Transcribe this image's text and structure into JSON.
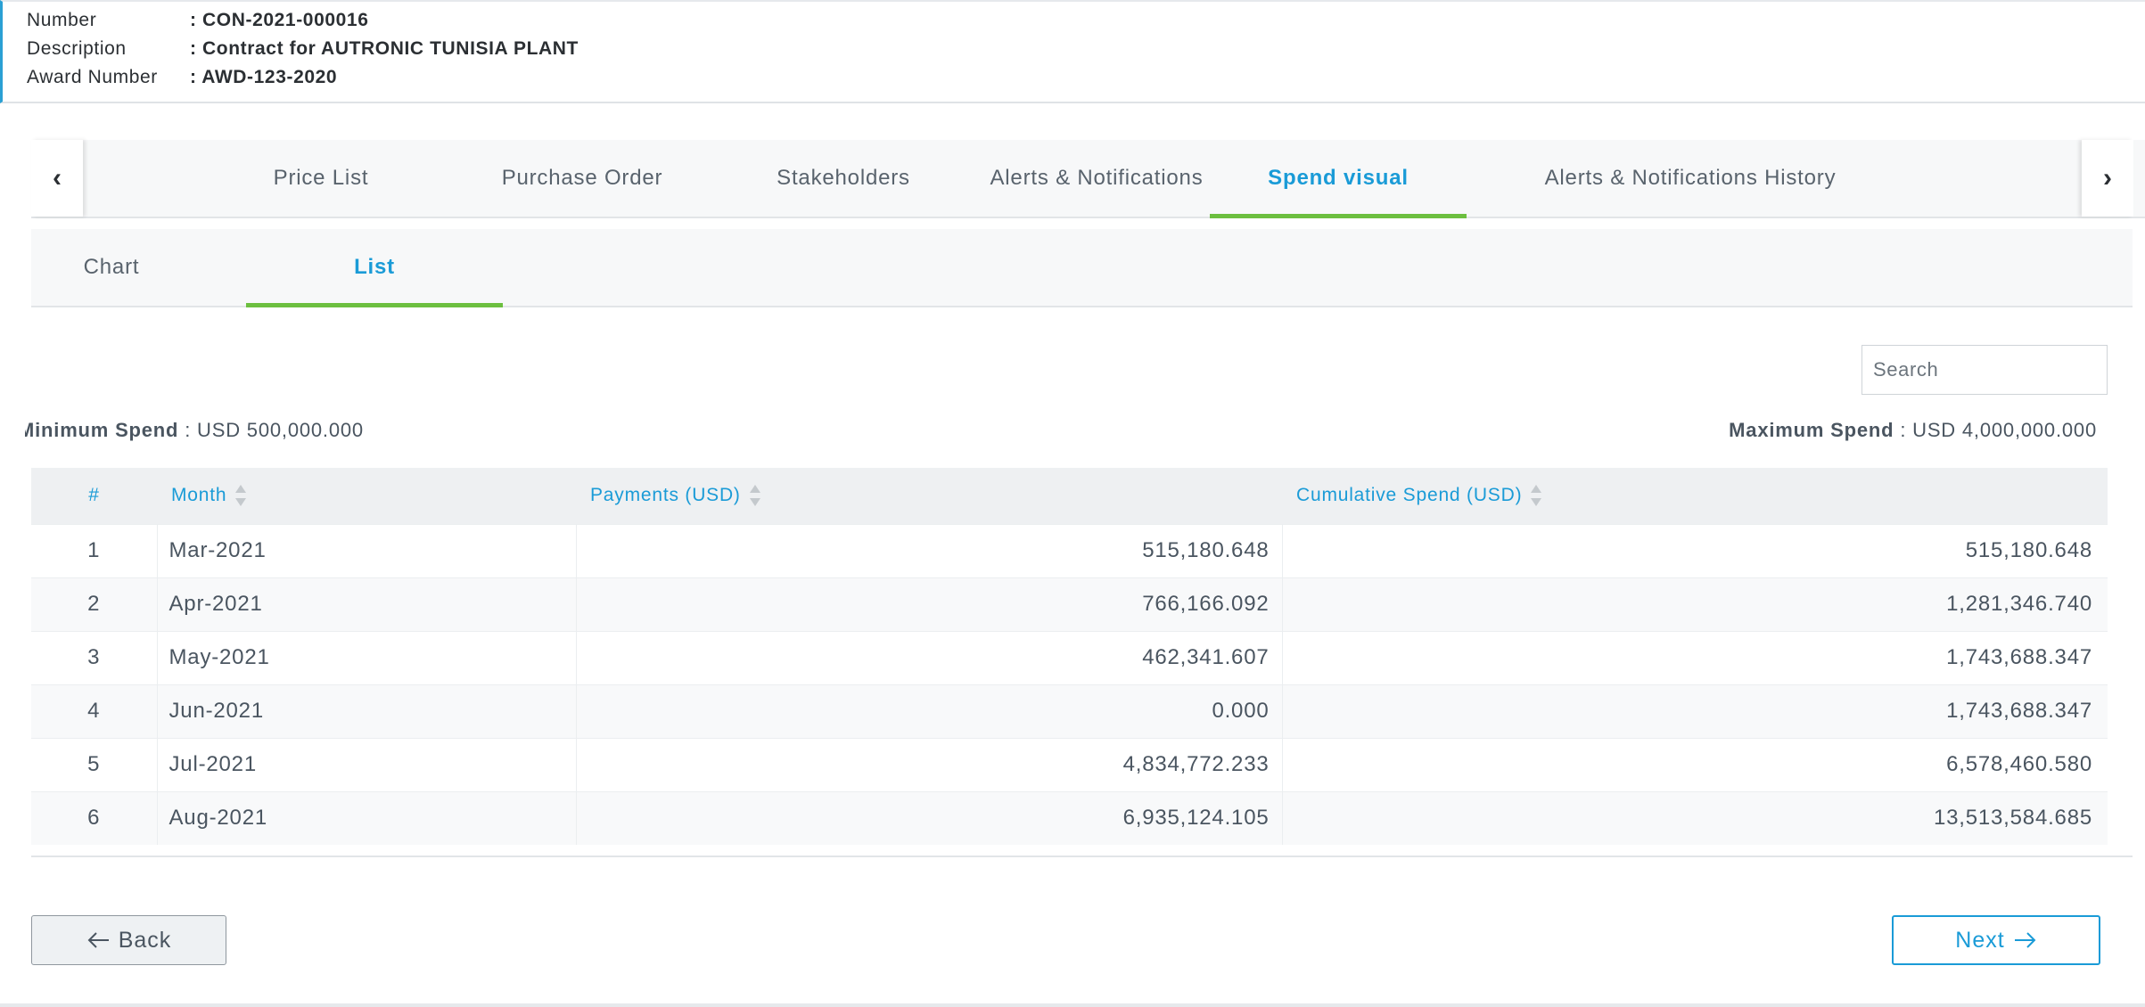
{
  "contract": {
    "number_label": "Number",
    "number_value": ": CON-2021-000016",
    "description_label": "Description",
    "description_value": ": Contract for AUTRONIC TUNISIA PLANT",
    "award_label": "Award Number",
    "award_value": ": AWD-123-2020"
  },
  "main_tabs": [
    {
      "label": "Price List"
    },
    {
      "label": "Purchase Order"
    },
    {
      "label": "Stakeholders"
    },
    {
      "label": "Alerts & Notifications"
    },
    {
      "label": "Spend visual",
      "active": true
    },
    {
      "label": "Alerts & Notifications History"
    }
  ],
  "scroll": {
    "left_icon": "chevron-left-icon",
    "right_icon": "chevron-right-icon",
    "left_glyph": "‹",
    "right_glyph": "›"
  },
  "sub_tabs": [
    {
      "label": "Chart"
    },
    {
      "label": "List",
      "active": true
    }
  ],
  "search": {
    "placeholder": "Search",
    "value": ""
  },
  "spend": {
    "min_label": "Minimum Spend",
    "min_value": ": USD 500,000.000",
    "max_label": "Maximum Spend",
    "max_value": ": USD 4,000,000.000"
  },
  "table": {
    "headers": {
      "idx": "#",
      "month": "Month",
      "payments": "Payments (USD)",
      "cumulative": "Cumulative Spend (USD)"
    },
    "rows": [
      {
        "idx": "1",
        "month": "Mar-2021",
        "payments": "515,180.648",
        "cumulative": "515,180.648"
      },
      {
        "idx": "2",
        "month": "Apr-2021",
        "payments": "766,166.092",
        "cumulative": "1,281,346.740"
      },
      {
        "idx": "3",
        "month": "May-2021",
        "payments": "462,341.607",
        "cumulative": "1,743,688.347"
      },
      {
        "idx": "4",
        "month": "Jun-2021",
        "payments": "0.000",
        "cumulative": "1,743,688.347"
      },
      {
        "idx": "5",
        "month": "Jul-2021",
        "payments": "4,834,772.233",
        "cumulative": "6,578,460.580"
      },
      {
        "idx": "6",
        "month": "Aug-2021",
        "payments": "6,935,124.105",
        "cumulative": "13,513,584.685"
      }
    ]
  },
  "buttons": {
    "back_label": "Back",
    "next_label": "Next"
  },
  "colors": {
    "accent": "#1a9bd7",
    "active_underline": "#6cbf3f",
    "text": "#4a5560"
  }
}
